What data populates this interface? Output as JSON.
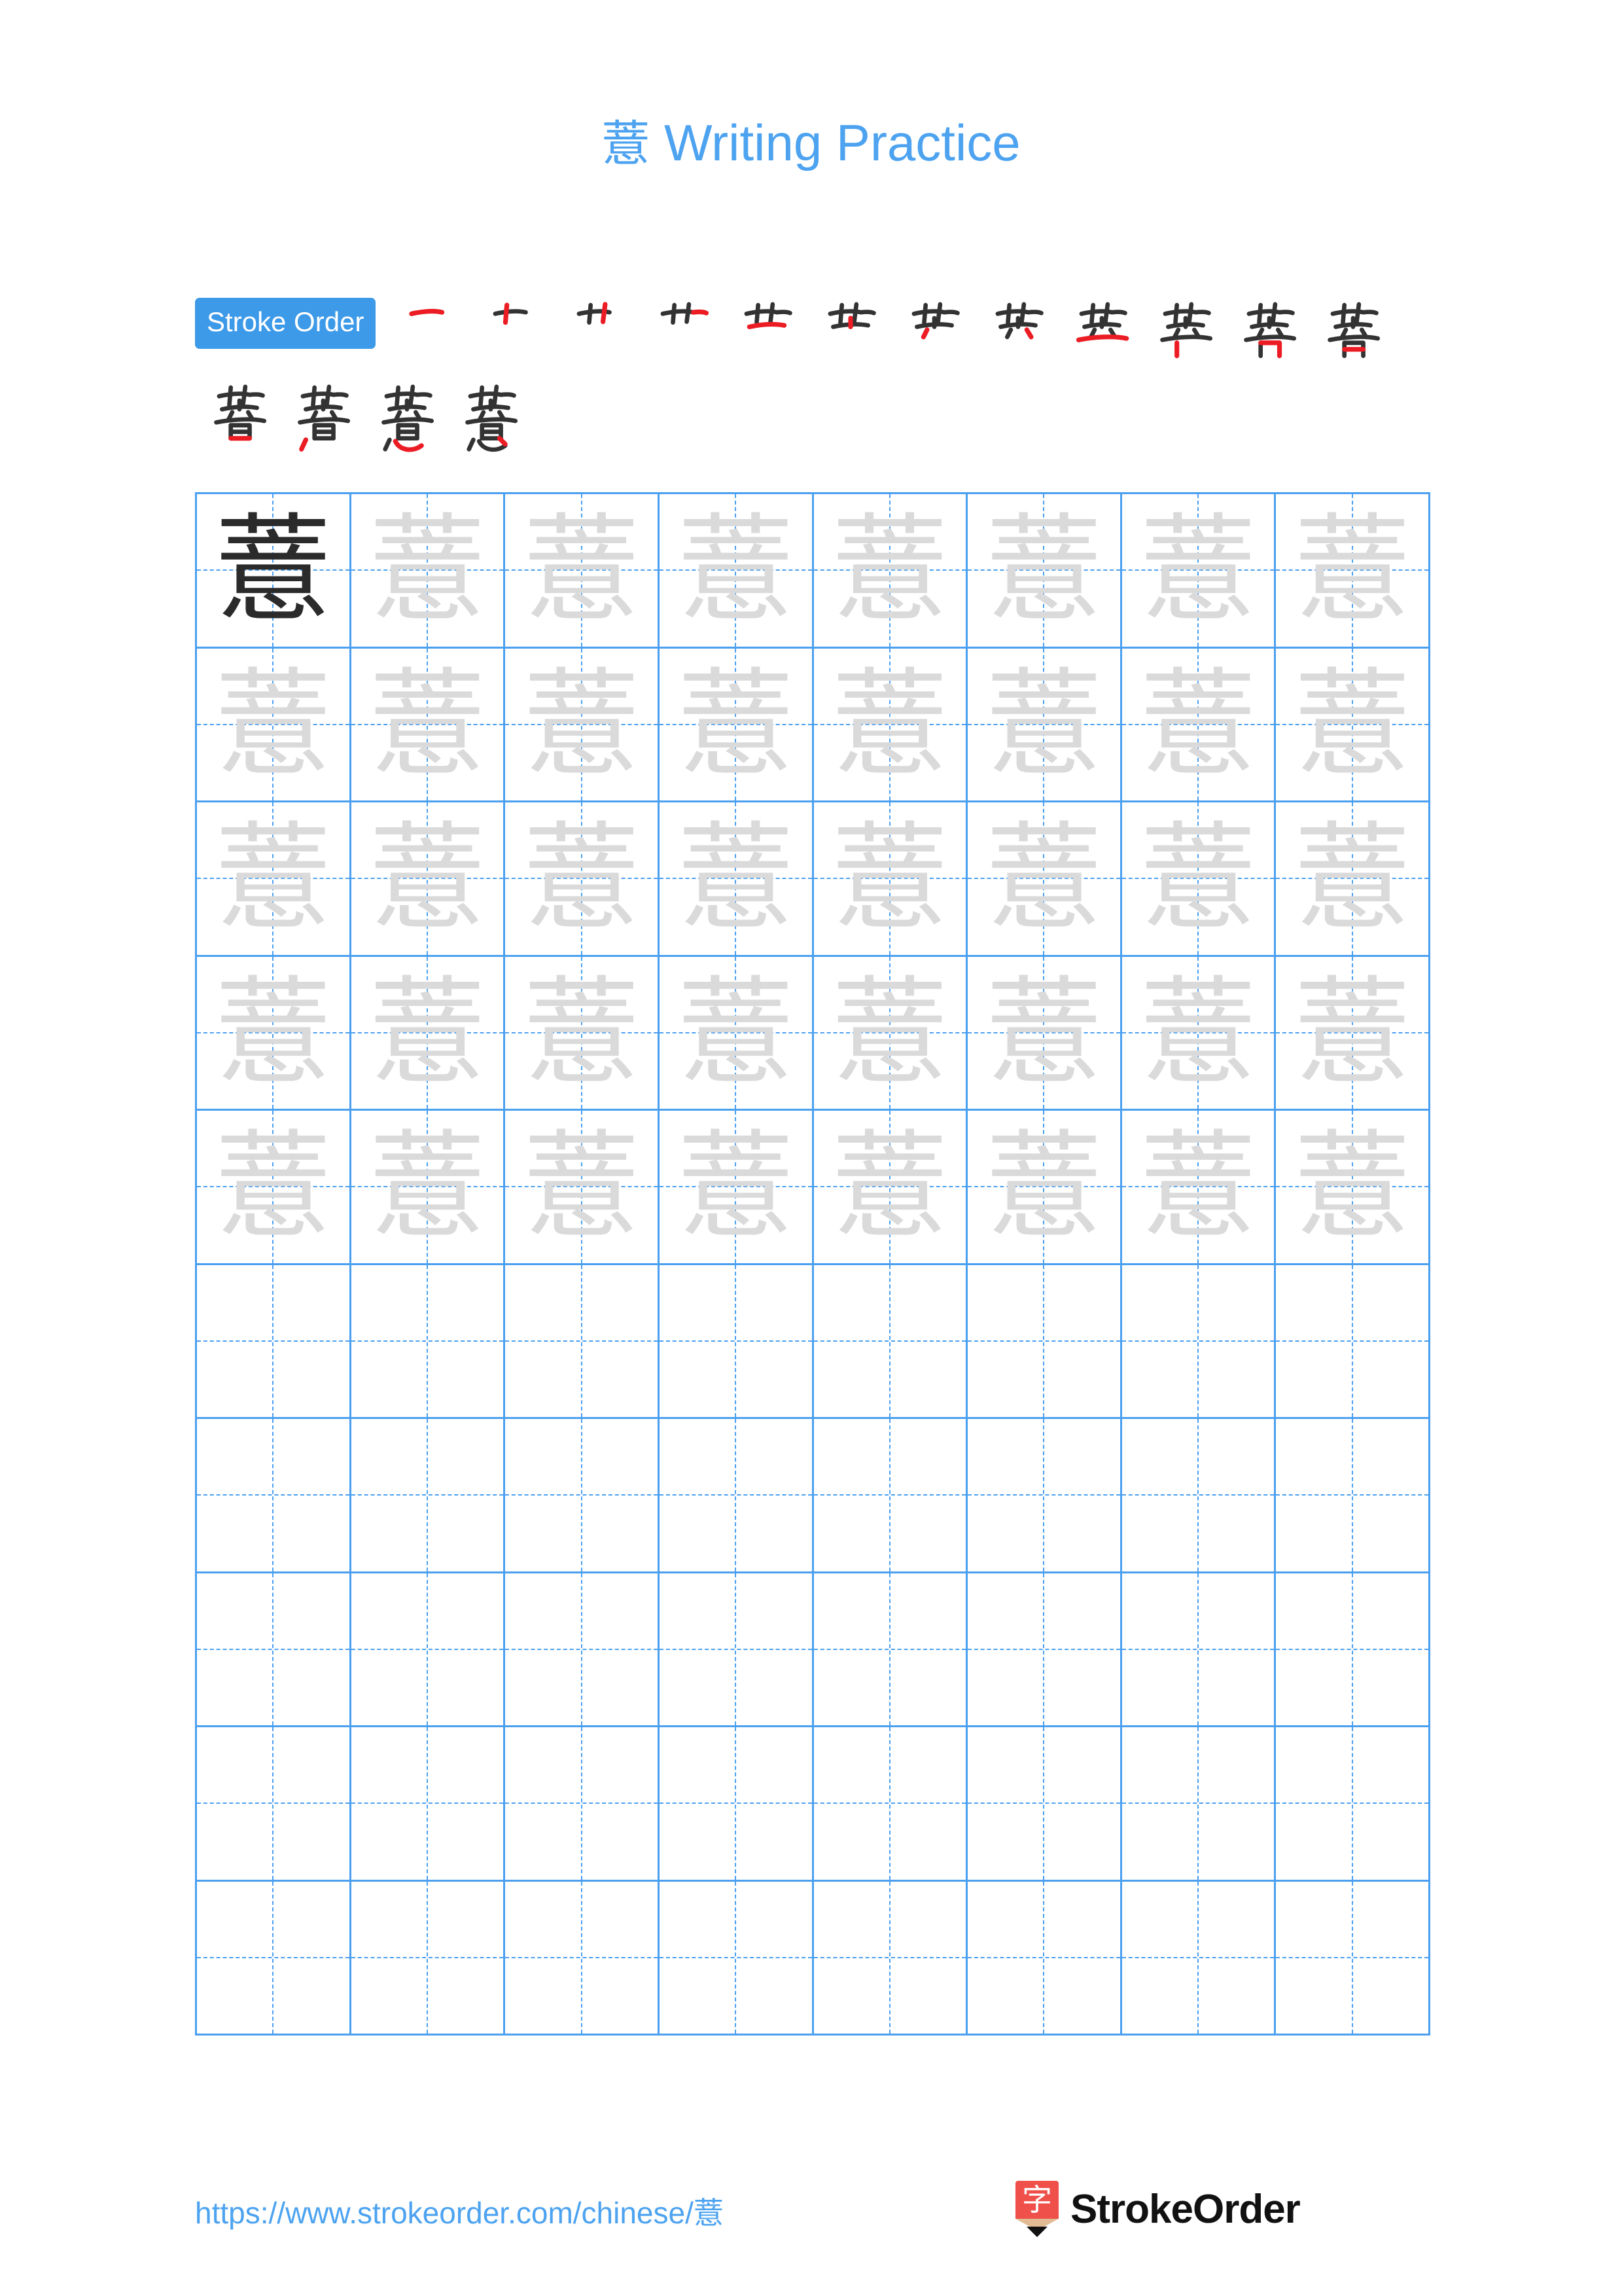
{
  "page": {
    "character": "薏",
    "title_suffix": " Writing Practice",
    "background_color": "#ffffff"
  },
  "colors": {
    "accent_blue": "#4da3f0",
    "badge_blue": "#3d9ae8",
    "grid_blue": "#4a9ff0",
    "trace_gray": "#dadada",
    "solid_ink": "#2b2b2b",
    "stroke_highlight_red": "#ec1c24",
    "stroke_ink": "#333333",
    "logo_red": "#f0504a",
    "logo_wood": "#e0bb93"
  },
  "stroke_order": {
    "badge_label": "Stroke Order",
    "total_strokes": 16,
    "row1_count": 12,
    "row2_count": 4,
    "steps": [
      {
        "index": 1,
        "partial": "一"
      },
      {
        "index": 2,
        "partial": "十"
      },
      {
        "index": 3,
        "partial": "艹"
      },
      {
        "index": 4,
        "partial": "艹"
      },
      {
        "index": 5,
        "partial": "芏"
      },
      {
        "index": 6,
        "partial": "芏"
      },
      {
        "index": 7,
        "partial": "芐"
      },
      {
        "index": 8,
        "partial": "芏"
      },
      {
        "index": 9,
        "partial": "苙"
      },
      {
        "index": 10,
        "partial": "苦"
      },
      {
        "index": 11,
        "partial": "菩"
      },
      {
        "index": 12,
        "partial": "菩"
      },
      {
        "index": 13,
        "partial": "菩"
      },
      {
        "index": 14,
        "partial": "薏"
      },
      {
        "index": 15,
        "partial": "薏"
      },
      {
        "index": 16,
        "partial": "薏"
      }
    ]
  },
  "practice_grid": {
    "columns": 8,
    "rows": 10,
    "filled_rows": 5,
    "empty_rows": 5,
    "solid_cells": 1,
    "guide_style": "dashed-crosshair"
  },
  "footer": {
    "url": "https://www.strokeorder.com/chinese/薏",
    "brand_name": "StrokeOrder",
    "logo_glyph": "字"
  }
}
